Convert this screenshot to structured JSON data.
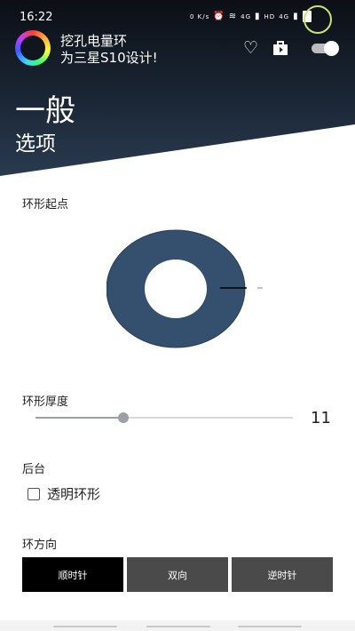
{
  "status_bar": {
    "time": "16:22",
    "speed": "0 K/s",
    "network_a": "4G",
    "hd": "HD",
    "network_b": "4G"
  },
  "header": {
    "app_title_line1": "挖孔电量环",
    "app_title_line2": "为三星S10设计!",
    "page_title": "一般",
    "page_subtitle": "选项",
    "icons": {
      "favorite": "heart-icon",
      "store": "shopping-bag-icon",
      "toggle": "toggle-switch"
    }
  },
  "settings": {
    "ring_start_label": "环形起点",
    "ring_thickness_label": "环形厚度",
    "ring_thickness_value": "11",
    "ring_thickness_fraction": 0.34,
    "background_label": "后台",
    "transparent_ring_label": "透明环形",
    "transparent_ring_checked": false,
    "direction_label": "环方向",
    "direction_options": [
      "顺时针",
      "双向",
      "逆时针"
    ],
    "direction_selected": "顺时针"
  },
  "colors": {
    "ring_fill": "#34506e",
    "button_active": "#000000",
    "button_inactive": "#4a4a4a"
  }
}
